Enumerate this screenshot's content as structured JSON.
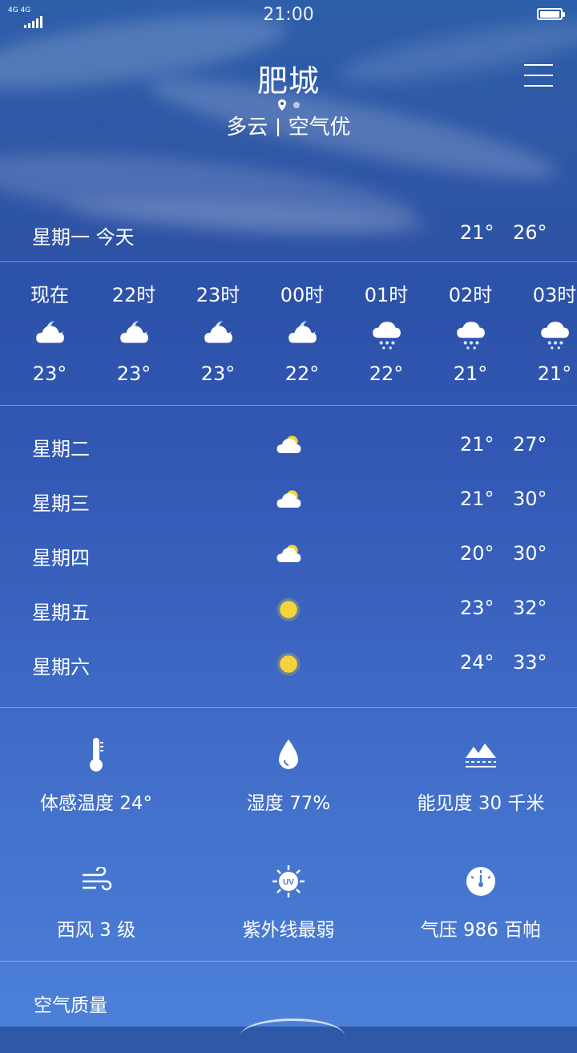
{
  "status_bar": {
    "network": "4G 4G",
    "time": "21:00"
  },
  "header": {
    "city": "肥城",
    "weather_summary": "多云 | 空气优"
  },
  "today": {
    "label": "星期一 今天",
    "low": "21°",
    "high": "26°"
  },
  "hourly": [
    {
      "time": "现在",
      "icon": "night-partly-cloudy-icon",
      "temp": "23°"
    },
    {
      "time": "22时",
      "icon": "night-partly-cloudy-icon",
      "temp": "23°"
    },
    {
      "time": "23时",
      "icon": "night-partly-cloudy-icon",
      "temp": "23°"
    },
    {
      "time": "00时",
      "icon": "night-partly-cloudy-icon",
      "temp": "22°"
    },
    {
      "time": "01时",
      "icon": "light-rain-icon",
      "temp": "22°"
    },
    {
      "time": "02时",
      "icon": "light-rain-icon",
      "temp": "21°"
    },
    {
      "time": "03时",
      "icon": "light-rain-icon",
      "temp": "21°"
    }
  ],
  "daily": [
    {
      "day": "星期二",
      "icon": "partly-cloudy-icon",
      "low": "21°",
      "high": "27°"
    },
    {
      "day": "星期三",
      "icon": "partly-cloudy-icon",
      "low": "21°",
      "high": "30°"
    },
    {
      "day": "星期四",
      "icon": "partly-cloudy-icon",
      "low": "20°",
      "high": "30°"
    },
    {
      "day": "星期五",
      "icon": "sunny-icon",
      "low": "23°",
      "high": "32°"
    },
    {
      "day": "星期六",
      "icon": "sunny-icon",
      "low": "24°",
      "high": "33°"
    }
  ],
  "details": [
    {
      "icon": "thermometer-icon",
      "text": "体感温度 24°"
    },
    {
      "icon": "droplet-icon",
      "text": "湿度 77%"
    },
    {
      "icon": "visibility-mountain-icon",
      "text": "能见度 30 千米"
    },
    {
      "icon": "wind-icon",
      "text": "西风 3 级"
    },
    {
      "icon": "uv-sun-icon",
      "text": "紫外线最弱"
    },
    {
      "icon": "pressure-gauge-icon",
      "text": "气压 986 百帕"
    }
  ],
  "air_quality": {
    "title": "空气质量"
  },
  "colors": {
    "sun": "#f5d33a",
    "cloud": "#ffffff",
    "moon": "#bfe6ff",
    "rain": "#cfe7ff"
  }
}
